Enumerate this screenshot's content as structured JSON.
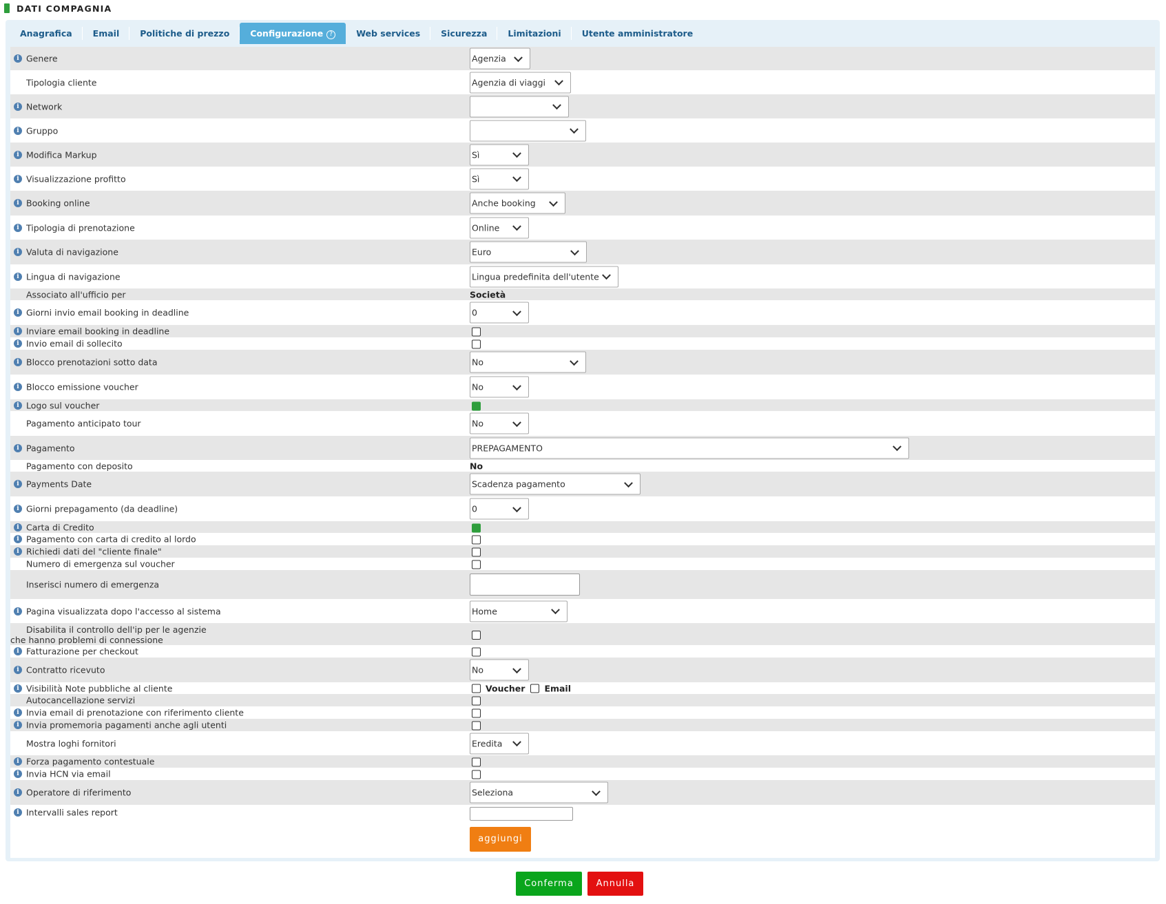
{
  "header": {
    "title": "DATI COMPAGNIA"
  },
  "tabs": [
    {
      "label": "Anagrafica"
    },
    {
      "label": "Email"
    },
    {
      "label": "Politiche di prezzo"
    },
    {
      "label": "Configurazione",
      "active": true,
      "help_icon": "?"
    },
    {
      "label": "Web services"
    },
    {
      "label": "Sicurezza"
    },
    {
      "label": "Limitazioni"
    },
    {
      "label": "Utente amministratore"
    }
  ],
  "info_icon_glyph": "i",
  "fields": {
    "genere": {
      "label": "Genere",
      "value": "Agenzia"
    },
    "tipologia_cliente": {
      "label": "Tipologia cliente",
      "value": "Agenzia di viaggi"
    },
    "network": {
      "label": "Network",
      "value": ""
    },
    "gruppo": {
      "label": "Gruppo",
      "value": ""
    },
    "modifica_markup": {
      "label": "Modifica Markup",
      "value": "Sì"
    },
    "visualizzazione_profitto": {
      "label": "Visualizzazione profitto",
      "value": "Sì"
    },
    "booking_online": {
      "label": "Booking online",
      "value": "Anche booking"
    },
    "tipologia_prenotazione": {
      "label": "Tipologia di prenotazione",
      "value": "Online"
    },
    "valuta_navigazione": {
      "label": "Valuta di navigazione",
      "value": "Euro"
    },
    "lingua_navigazione": {
      "label": "Lingua di navigazione",
      "value": "Lingua predefinita dell'utente"
    },
    "associato_ufficio": {
      "label": "Associato all'ufficio per",
      "value": "Società"
    },
    "giorni_invio_email": {
      "label": "Giorni invio email booking in deadline",
      "value": "0"
    },
    "inviare_email_deadline": {
      "label": "Inviare email booking in deadline",
      "checked": false
    },
    "invio_email_sollecito": {
      "label": "Invio email di sollecito",
      "checked": false
    },
    "blocco_prenotazioni": {
      "label": "Blocco prenotazioni sotto data",
      "value": "No"
    },
    "blocco_emissione_voucher": {
      "label": "Blocco emissione voucher",
      "value": "No"
    },
    "logo_voucher": {
      "label": "Logo sul voucher",
      "checked": true
    },
    "pagamento_anticipato_tour": {
      "label": "Pagamento anticipato tour",
      "value": "No"
    },
    "pagamento": {
      "label": "Pagamento",
      "value": "PREPAGAMENTO"
    },
    "pagamento_deposito": {
      "label": "Pagamento con deposito",
      "value": "No"
    },
    "payments_date": {
      "label": "Payments Date",
      "value": "Scadenza pagamento"
    },
    "giorni_prepagamento": {
      "label": "Giorni prepagamento (da deadline)",
      "value": "0"
    },
    "carta_credito": {
      "label": "Carta di Credito",
      "checked": true
    },
    "pagamento_carta_lordo": {
      "label": "Pagamento con carta di credito al lordo",
      "checked": false
    },
    "richiedi_dati_cliente": {
      "label": "Richiedi dati del \"cliente finale\"",
      "checked": false
    },
    "numero_emergenza_voucher": {
      "label": "Numero di emergenza sul voucher",
      "checked": false
    },
    "inserisci_numero_emergenza": {
      "label": "Inserisci numero di emergenza",
      "value": ""
    },
    "pagina_dopo_accesso": {
      "label": "Pagina visualizzata dopo l'accesso al sistema",
      "value": "Home"
    },
    "disabilita_controllo_ip": {
      "label_line1": "Disabilita il controllo dell'ip per le agenzie",
      "label_line2": "che hanno problemi di connessione",
      "checked": false
    },
    "fatturazione_checkout": {
      "label": "Fatturazione per checkout",
      "checked": false
    },
    "contratto_ricevuto": {
      "label": "Contratto ricevuto",
      "value": "No"
    },
    "visibilita_note": {
      "label": "Visibilità Note pubbliche al cliente",
      "voucher_label": "Voucher",
      "email_label": "Email"
    },
    "autocancellazione": {
      "label": "Autocancellazione servizi",
      "checked": false
    },
    "invia_email_riferimento": {
      "label": "Invia email di prenotazione con riferimento cliente",
      "checked": false
    },
    "invia_promemoria": {
      "label": "Invia promemoria pagamenti anche agli utenti",
      "checked": false
    },
    "mostra_loghi": {
      "label": "Mostra loghi fornitori",
      "value": "Eredita"
    },
    "forza_pagamento": {
      "label": "Forza pagamento contestuale",
      "checked": false
    },
    "invia_hcn": {
      "label": "Invia HCN via email",
      "checked": false
    },
    "operatore_riferimento": {
      "label": "Operatore di riferimento",
      "value": "Seleziona"
    },
    "intervalli_sales": {
      "label": "Intervalli sales report",
      "value": "",
      "add_button": "aggiungi"
    }
  },
  "footer": {
    "confirm": "Conferma",
    "cancel": "Annulla"
  },
  "colors": {
    "accent_tab": "#55aedb",
    "confirm": "#0aa51c",
    "cancel": "#e31010",
    "add": "#f07e12",
    "check_on": "#2e9e3c"
  }
}
